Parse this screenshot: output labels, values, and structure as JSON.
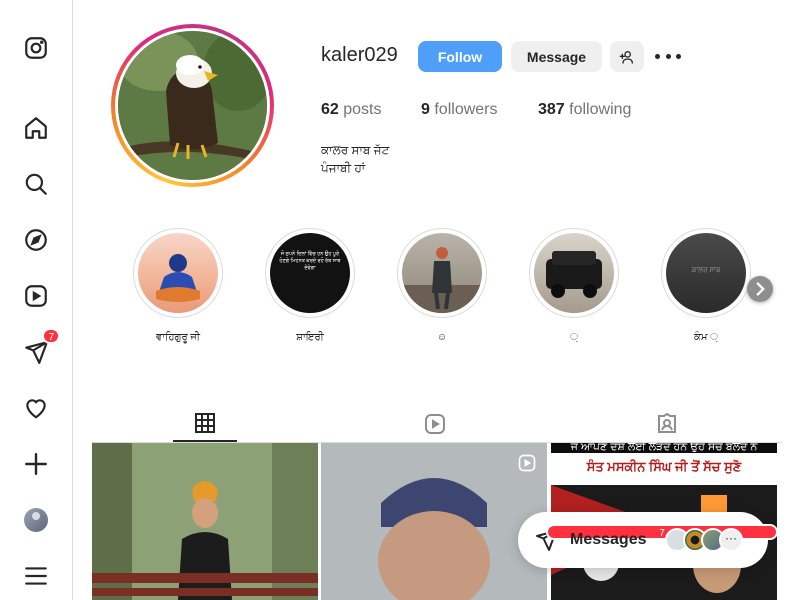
{
  "sidebar": {
    "items": [
      {
        "name": "instagram-logo-icon"
      },
      {
        "name": "home-icon"
      },
      {
        "name": "search-icon"
      },
      {
        "name": "explore-icon"
      },
      {
        "name": "reels-icon"
      },
      {
        "name": "messages-icon",
        "badge": "7"
      },
      {
        "name": "notifications-icon"
      },
      {
        "name": "create-icon"
      },
      {
        "name": "profile-avatar"
      },
      {
        "name": "menu-icon"
      }
    ]
  },
  "profile": {
    "username": "kaler029",
    "follow_label": "Follow",
    "message_label": "Message",
    "stats": {
      "posts_count": "62",
      "posts_label": "posts",
      "followers_count": "9",
      "followers_label": "followers",
      "following_count": "387",
      "following_label": "following"
    },
    "bio_line1": "ਕਾਲਰ ਸਾਬ ਜੱਟ",
    "bio_line2": "ਪੰਜਾਬੀ ਹਾਂ"
  },
  "highlights": [
    {
      "label": "ਵਾਹਿਗੁਰੂ ਜੀ"
    },
    {
      "label": "ਸ਼ਾਇਰੀ"
    },
    {
      "label": "☺"
    },
    {
      "label": "਼"
    },
    {
      "label": "ਕੰਮ ਼"
    }
  ],
  "highlight_images": {
    "h2_text": "ਜੋ ਸੁਪਨੇ ਦਿਲਾਂ ਵਿੱਚ ਹਨ ਉਹ ਪੂਰੇ ਹੋਣਗੇ ਮਿਹਨਤ ਕਰਦੇ ਰਹੋ ਰੱਬ ਸਾਥ ਦੇਵੇਗਾ",
    "h5_text": "ਕਾਲਰ ਸਾਬ"
  },
  "tabs": [
    {
      "name": "posts-grid-tab",
      "active": true
    },
    {
      "name": "reels-tab",
      "active": false
    },
    {
      "name": "tagged-tab",
      "active": false
    }
  ],
  "posts": {
    "post3_caption_top": "ਜੋ ਆਪਣੇ ਦੇਸ਼ ਲਈ ਲੜਦੇ ਹਨ ਉਹ ਸੱਚ ਬੋਲਦੇ ਨੇ",
    "post3_caption_main": "ਸੰਤ ਮਸਕੀਨ ਸਿੰਘ ਜੀ ਤੋਂ ਸੱਚ ਸੁਣੋ"
  },
  "messages": {
    "label": "Messages",
    "badge": "7"
  }
}
